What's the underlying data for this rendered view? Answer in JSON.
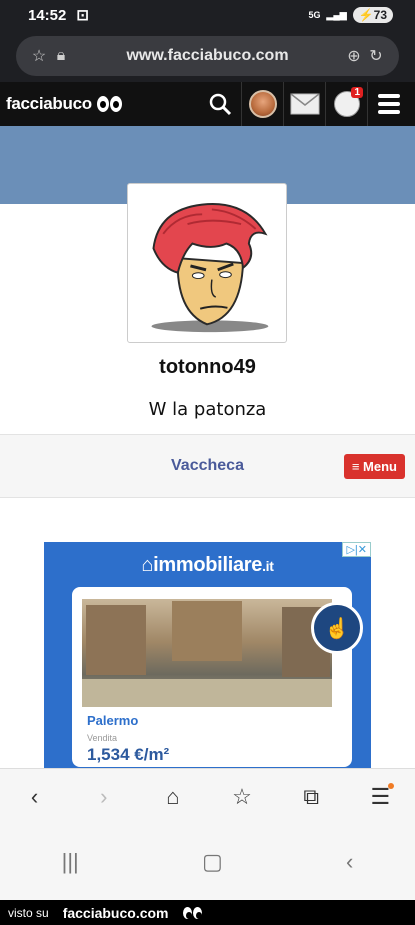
{
  "status": {
    "time": "14:52",
    "network": "5G",
    "battery": "73"
  },
  "browser": {
    "url": "www.facciabuco.com"
  },
  "site": {
    "logo": "facciabuco",
    "notif_count": "1"
  },
  "profile": {
    "username": "totonno49",
    "motto": "W la patonza"
  },
  "menu": {
    "section": "Vaccheca",
    "button": "≡ Menu"
  },
  "ad": {
    "brand": "immobiliare",
    "brand_suffix": ".it",
    "city": "Palermo",
    "type": "Vendita",
    "price": "1,534 €/m²"
  },
  "footer": {
    "prefix": "visto su",
    "site": "facciabuco.com"
  },
  "colors": {
    "cover": "#6b8fb8",
    "menu_button": "#d9322d",
    "ad_bg": "#2d6fcb",
    "header_bg": "#111111"
  }
}
